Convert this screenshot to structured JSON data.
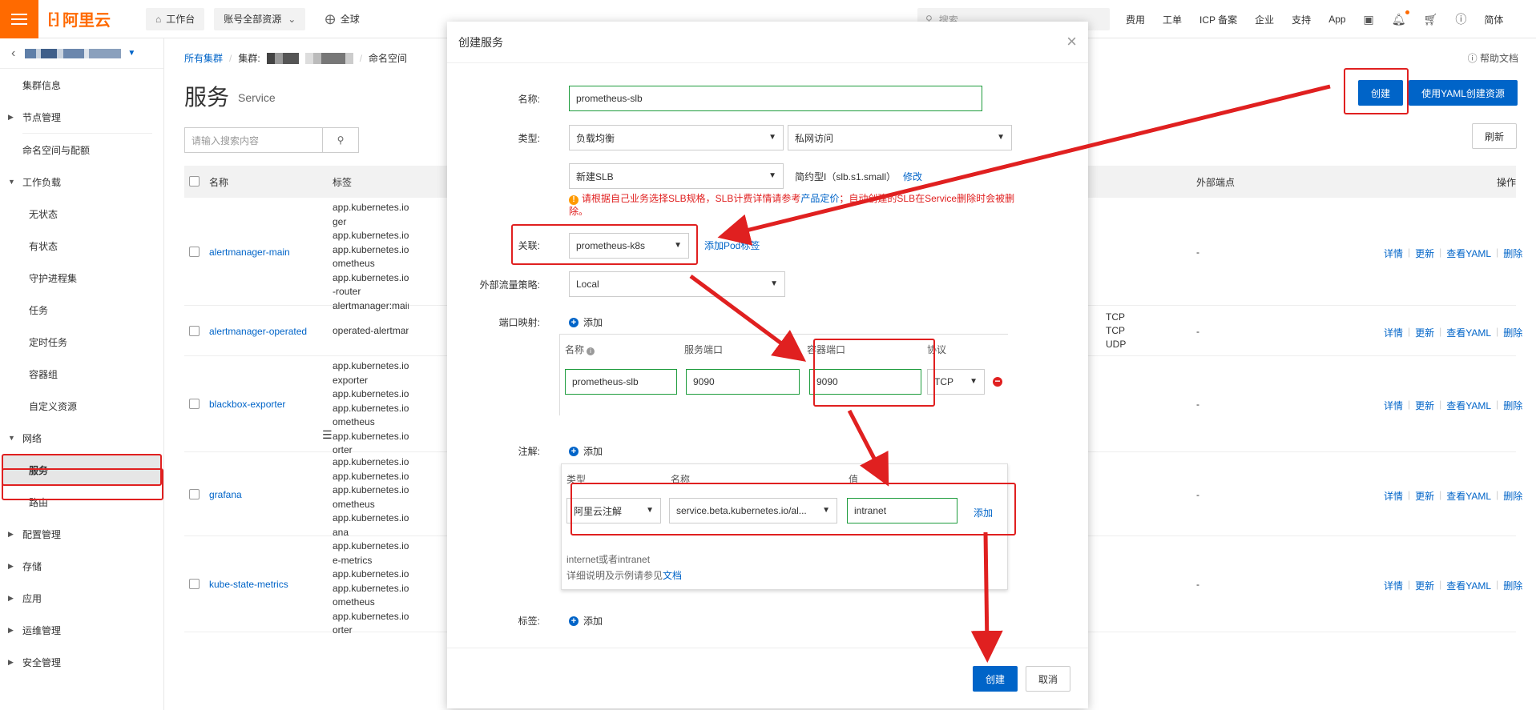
{
  "topbar": {
    "logo": "阿里云",
    "logo_bracket": "[-]",
    "workbench": "工作台",
    "account_resources": "账号全部资源",
    "region": "全球",
    "search_placeholder": "搜索...",
    "links": [
      "费用",
      "工单",
      "ICP 备案",
      "企业",
      "支持",
      "App"
    ],
    "lang": "简体"
  },
  "sidebar": {
    "items": [
      {
        "type": "top",
        "label": "集群信息"
      },
      {
        "type": "group",
        "label": "节点管理"
      },
      {
        "type": "top",
        "label": "命名空间与配额"
      },
      {
        "type": "group",
        "label": "工作负载",
        "open": true
      },
      {
        "type": "sub",
        "label": "无状态"
      },
      {
        "type": "sub",
        "label": "有状态"
      },
      {
        "type": "sub",
        "label": "守护进程集"
      },
      {
        "type": "sub",
        "label": "任务"
      },
      {
        "type": "sub",
        "label": "定时任务"
      },
      {
        "type": "sub",
        "label": "容器组"
      },
      {
        "type": "sub",
        "label": "自定义资源"
      },
      {
        "type": "group",
        "label": "网络",
        "open": true
      },
      {
        "type": "sub",
        "label": "服务",
        "active": true
      },
      {
        "type": "sub",
        "label": "路由"
      },
      {
        "type": "group",
        "label": "配置管理"
      },
      {
        "type": "group",
        "label": "存储"
      },
      {
        "type": "group",
        "label": "应用"
      },
      {
        "type": "group",
        "label": "运维管理"
      },
      {
        "type": "group",
        "label": "安全管理"
      }
    ]
  },
  "main": {
    "breadcrumb": {
      "all_clusters": "所有集群",
      "cluster": "集群:",
      "namespace": "命名空间"
    },
    "help_doc": "帮助文档",
    "title": "服务",
    "subtitle": "Service",
    "search_placeholder": "请输入搜索内容",
    "create_btn": "创建",
    "yaml_btn": "使用YAML创建资源",
    "refresh_btn": "刷新",
    "columns": {
      "name": "名称",
      "labels": "标签",
      "external": "外部端点",
      "ops": "操作"
    },
    "ops": [
      "详情",
      "更新",
      "查看YAML",
      "删除"
    ],
    "rows": [
      {
        "name": "alertmanager-main",
        "labels": [
          "app.kubernetes.io",
          "ger",
          "app.kubernetes.io",
          "app.kubernetes.io",
          "ometheus",
          "app.kubernetes.io",
          "-router",
          "alertmanager:main"
        ],
        "ext": "-"
      },
      {
        "name": "alertmanager-operated",
        "labels": [
          "operated-alertmanager"
        ],
        "ext": "-",
        "ports": [
          "TCP",
          "TCP",
          "UDP"
        ]
      },
      {
        "name": "blackbox-exporter",
        "labels": [
          "app.kubernetes.io",
          "exporter",
          "app.kubernetes.io",
          "app.kubernetes.io",
          "ometheus",
          "app.kubernetes.io",
          "orter"
        ],
        "ext": "-"
      },
      {
        "name": "grafana",
        "labels": [
          "app.kubernetes.io",
          "app.kubernetes.io",
          "app.kubernetes.io",
          "ometheus",
          "app.kubernetes.io",
          "ana"
        ],
        "ext": "-"
      },
      {
        "name": "kube-state-metrics",
        "labels": [
          "app.kubernetes.io",
          "e-metrics",
          "app.kubernetes.io",
          "app.kubernetes.io",
          "ometheus",
          "app.kubernetes.io",
          "orter"
        ],
        "ext": "-"
      }
    ]
  },
  "modal": {
    "title": "创建服务",
    "close": "×",
    "name_label": "名称:",
    "name_value": "prometheus-slb",
    "type_label": "类型:",
    "type_value": "负载均衡",
    "access_value": "私网访问",
    "slb_value": "新建SLB",
    "slb_spec": "简约型I（slb.s1.small）",
    "modify": "修改",
    "warning_1": "请根据自己业务选择SLB规格，SLB计费详情请参考",
    "warning_link": "产品定价",
    "warning_2": "；自动创建的SLB在Service删除时会被删除。",
    "assoc_label": "关联:",
    "assoc_value": "prometheus-k8s",
    "add_pod_label": "添加Pod标签",
    "traffic_label": "外部流量策略:",
    "traffic_value": "Local",
    "port_label": "端口映射:",
    "add": "添加",
    "port_cols": {
      "name": "名称",
      "service_port": "服务端口",
      "container_port": "容器端口",
      "protocol": "协议"
    },
    "port_row": {
      "name": "prometheus-slb",
      "service_port": "9090",
      "container_port": "9090",
      "protocol": "TCP"
    },
    "anno_label": "注解:",
    "anno_cols": {
      "type": "类型",
      "name": "名称",
      "value": "值"
    },
    "anno_row": {
      "type": "阿里云注解",
      "name": "service.beta.kubernetes.io/al...",
      "value": "intranet",
      "add": "添加"
    },
    "anno_hint_1": "internet或者intranet",
    "anno_hint_2": "详细说明及示例请参见",
    "anno_hint_link": "文档",
    "tag_label": "标签:",
    "create": "创建",
    "cancel": "取消"
  },
  "colors": {
    "accent": "#0064c8",
    "brand": "#ff6a00",
    "highlight": "#e02020",
    "valid": "#1e9c3d"
  }
}
